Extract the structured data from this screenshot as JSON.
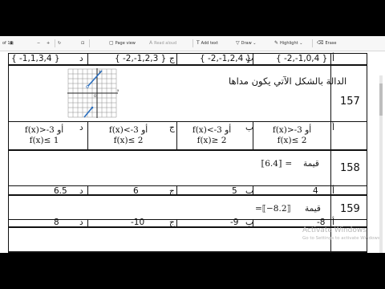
{
  "toolbar": {
    "page_indicator": "of 18",
    "items": [
      "Page view",
      "Read aloud",
      "Add text",
      "Draw",
      "Highlight",
      "Erase"
    ],
    "icons": [
      "save-icon",
      "zoom-out-icon",
      "zoom-in-icon",
      "rotate-icon",
      "fit-page-icon",
      "page-view-icon",
      "read-aloud-icon",
      "add-text-icon",
      "draw-icon",
      "highlight-icon",
      "erase-icon"
    ]
  },
  "top_row": {
    "label_a": "أ",
    "label_b": "ب",
    "label_c": "ج",
    "label_d": "د",
    "option_a": "{ -2,-1,0,4 }",
    "option_b": "{ -2,-1,2,4 }",
    "option_c": "{ -2,-1,2,3 }",
    "option_d": "{ -1,1,3,4 }"
  },
  "q157": {
    "number": "157",
    "text": "الدالة بالشكل الآتي يكون مداها",
    "graph": {
      "x_label": "x",
      "y_label": "y",
      "origin_label": "O"
    },
    "label_a": "أ",
    "label_b": "ب",
    "label_c": "ج",
    "label_d": "د",
    "option_a": [
      "f(x)>-3 أو",
      "f(x)≤ 2"
    ],
    "option_b": [
      "f(x)<-3 أو",
      "f(x)≥ 2"
    ],
    "option_c": [
      "f(x)<-3 أو",
      "f(x)≤ 2"
    ],
    "option_d": [
      "f(x)>-3 أو",
      "f(x)≤ 1"
    ]
  },
  "q158": {
    "number": "158",
    "label_text": "قيمة",
    "expr": "⟦6.4⟧ =",
    "label_a": "أ",
    "label_b": "ب",
    "label_c": "ج",
    "label_d": "د",
    "option_a": "4",
    "option_b": "5",
    "option_c": "6",
    "option_d": "6.5"
  },
  "q159": {
    "number": "159",
    "label_text": "قيمة",
    "expr": "=⟦−8.2⟧",
    "label_a": "أ",
    "label_b": "ب",
    "label_c": "ج",
    "label_d": "د",
    "option_a": "-8",
    "option_b": "-9",
    "option_c": "-10",
    "option_d": "8"
  },
  "watermark": {
    "line1": "Activate Windows",
    "line2": "Go to Settings to activate Windows."
  },
  "colors": {
    "graph_line": "#2a6fbf",
    "toolbar_bg": "#f7f7f7",
    "frame_bg": "#000000"
  }
}
